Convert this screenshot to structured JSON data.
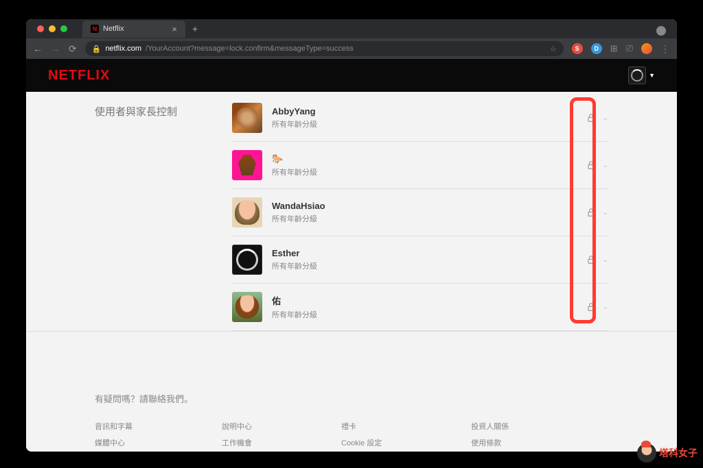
{
  "browser": {
    "tab_title": "Netflix",
    "url_domain": "netflix.com",
    "url_path": "/YourAccount?message=lock.confirm&messageType=success"
  },
  "header": {
    "logo_text": "NETFLIX"
  },
  "section": {
    "title": "使用者與家長控制",
    "rating_label": "所有年齡分級"
  },
  "profiles": [
    {
      "name": "AbbyYang",
      "rating": "所有年齡分級"
    },
    {
      "name": "🐎",
      "rating": "所有年齡分級"
    },
    {
      "name": "WandaHsiao",
      "rating": "所有年齡分級"
    },
    {
      "name": "Esther",
      "rating": "所有年齡分級"
    },
    {
      "name": "佑",
      "rating": "所有年齡分級"
    }
  ],
  "footer": {
    "question": "有疑問嗎？請聯絡我們。",
    "cols": [
      [
        "音訊和字幕",
        "媒體中心"
      ],
      [
        "說明中心",
        "工作機會"
      ],
      [
        "禮卡",
        "Cookie 設定"
      ],
      [
        "投資人關係",
        "使用條款"
      ]
    ]
  },
  "watermark": "塔科女子"
}
